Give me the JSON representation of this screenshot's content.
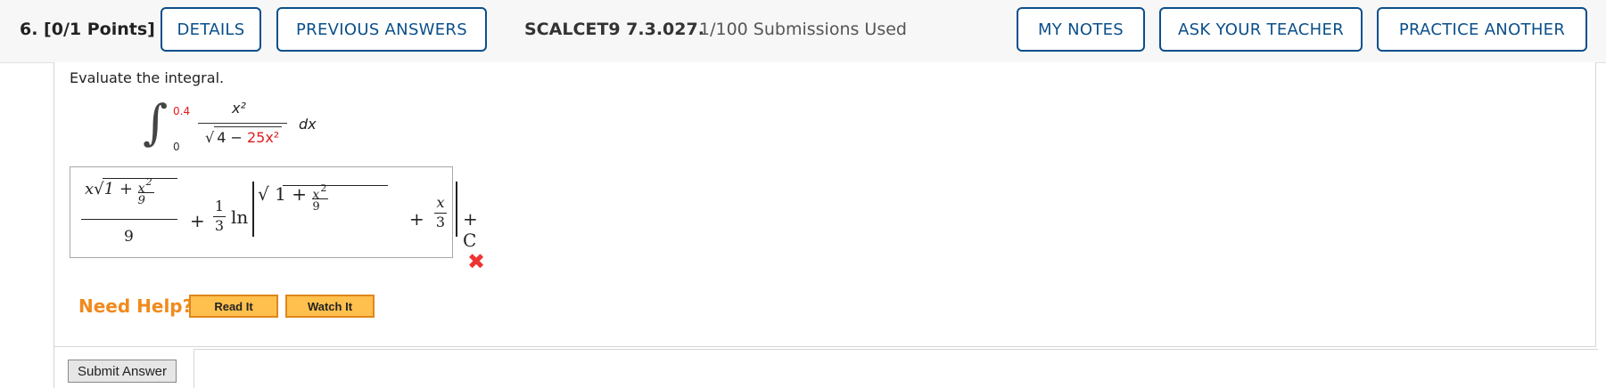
{
  "header": {
    "question_label": "6.  [0/1 Points]",
    "buttons": {
      "details": "DETAILS",
      "previous_answers": "PREVIOUS ANSWERS",
      "my_notes": "MY NOTES",
      "ask_teacher": "ASK YOUR TEACHER",
      "practice_another": "PRACTICE ANOTHER"
    },
    "problem_code": "SCALCET9 7.3.027.",
    "submissions": "1/100 Submissions Used"
  },
  "question": {
    "prompt": "Evaluate the integral.",
    "integral": {
      "upper_limit": "0.4",
      "lower_limit": "0",
      "numerator": "x²",
      "radicand_part1": "4 − ",
      "radicand_part2": "25x²",
      "differential": "dx"
    }
  },
  "answer": {
    "status_icon": "x-mark-icon",
    "parts": {
      "x": "x",
      "inner": "1 + ",
      "x2": "x",
      "sup2": "2",
      "nine": "9",
      "plus": "+",
      "one": "1",
      "three": "3",
      "ln": "ln",
      "x_over": "x",
      "C": "+ C"
    }
  },
  "help": {
    "label": "Need Help?",
    "read_it": "Read It",
    "watch_it": "Watch It"
  },
  "submit": {
    "label": "Submit Answer"
  },
  "colors": {
    "accent": "#0b4f8a",
    "highlight": "#e21b1b",
    "help": "#f08a1c",
    "help_btn": "#ffc04d"
  }
}
